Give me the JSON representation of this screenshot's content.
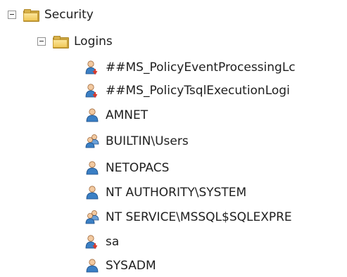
{
  "tree": {
    "security": {
      "label": "Security",
      "icon": "folder-icon"
    },
    "logins": {
      "label": "Logins",
      "icon": "folder-icon"
    },
    "items": [
      {
        "label": "##MS_PolicyEventProcessingLc",
        "icon": "login-disabled-icon"
      },
      {
        "label": "##MS_PolicyTsqlExecutionLogi",
        "icon": "login-disabled-icon"
      },
      {
        "label": "AMNET",
        "icon": "login-user-icon"
      },
      {
        "label": "BUILTIN\\Users",
        "icon": "login-group-icon"
      },
      {
        "label": "NETOPACS",
        "icon": "login-user-icon"
      },
      {
        "label": "NT AUTHORITY\\SYSTEM",
        "icon": "login-user-icon"
      },
      {
        "label": "NT SERVICE\\MSSQL$SQLEXPRE",
        "icon": "login-group-icon"
      },
      {
        "label": "sa",
        "icon": "login-disabled-icon"
      },
      {
        "label": "SYSADM",
        "icon": "login-user-icon"
      }
    ]
  },
  "colors": {
    "folder": "#f0c95a",
    "user_body": "#3a7fc4",
    "disabled_arrow": "#d83a2c",
    "text": "#1e1e1e"
  }
}
